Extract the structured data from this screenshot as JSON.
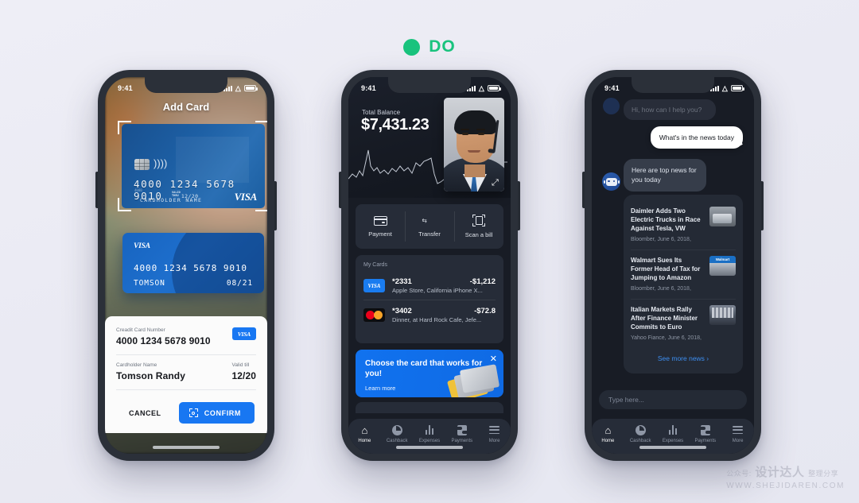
{
  "badge": {
    "label": "DO",
    "color": "#19c37d"
  },
  "watermark": {
    "line1_prefix": "公众号:",
    "line1_main": "设计达人",
    "line1_suffix": "整理分享",
    "line2": "WWW.SHEJIDAREN.COM"
  },
  "phone1": {
    "status": {
      "time": "9:41"
    },
    "title": "Add Card",
    "scanned_card": {
      "number": "4000 1234 5678 9010",
      "small_number": "4000",
      "valid_label": "VALID\nTHRU",
      "expiry": "12/20",
      "holder": "CARDHOLDER NAME",
      "brand": "VISA"
    },
    "preview_card": {
      "brand": "VISA",
      "number": "4000 1234 5678 9010",
      "holder": "TOMSON",
      "expiry": "08/21"
    },
    "form": {
      "number_label": "Creadit Card Number",
      "number_value": "4000 1234 5678 9010",
      "brand_chip": "VISA",
      "name_label": "Cardholder Name",
      "name_value": "Tomson Randy",
      "valid_label": "Valid till",
      "valid_value": "12/20",
      "cancel": "CANCEL",
      "confirm": "CONFIRM"
    }
  },
  "phone2": {
    "status": {
      "time": "9:41"
    },
    "balance_label": "Total Balance",
    "balance_amount": "$7,431.23",
    "quick_actions": [
      {
        "label": "Payment",
        "icon": "credit-card-icon"
      },
      {
        "label": "Transfer",
        "icon": "transfer-arrows-icon"
      },
      {
        "label": "Scan a bill",
        "icon": "scan-bill-icon"
      }
    ],
    "my_cards": {
      "title": "My Cards",
      "transactions": [
        {
          "brand": "VISA",
          "card": "*2331",
          "amount": "-$1,212",
          "desc": "Apple Store, California iPhone X..."
        },
        {
          "brand": "Mastercard",
          "card": "*3402",
          "amount": "-$72.8",
          "desc": "Dinner, at Hard Rock Cafe, Jefe..."
        }
      ]
    },
    "promo": {
      "headline": "Choose the card that works for you!",
      "link": "Learn more",
      "close": "✕"
    },
    "tabs": [
      {
        "label": "Home",
        "icon": "home-icon",
        "active": true
      },
      {
        "label": "Cashback",
        "icon": "pie-chart-icon",
        "active": false
      },
      {
        "label": "Expenses",
        "icon": "bar-chart-icon",
        "active": false
      },
      {
        "label": "Payments",
        "icon": "payments-icon",
        "active": false
      },
      {
        "label": "More",
        "icon": "hamburger-icon",
        "active": false
      }
    ]
  },
  "phone3": {
    "status": {
      "time": "9:41"
    },
    "messages": {
      "greeting": "Hi, how can I help you?",
      "user_query": "What's in the news today",
      "bot_reply": "Here are top news for you today"
    },
    "news": [
      {
        "title": "Daimler Adds Two Electric Trucks in Race Against Tesla, VW",
        "meta": "Bloomber, June 6, 2018,",
        "thumb": "truck-thumbnail"
      },
      {
        "title": "Walmart Sues Its Former Head of Tax for Jumping to Amazon",
        "meta": "Bloomber, June 6, 2018,",
        "thumb": "walmart-thumbnail",
        "thumb_text": "Walmart"
      },
      {
        "title": "Italian Markets Rally After Finance Minister Commits to Euro",
        "meta": "Yahoo Fiance, June 6, 2018,",
        "thumb": "market-thumbnail"
      }
    ],
    "see_more": "See more news ›",
    "composer_placeholder": "Type here...",
    "tabs": [
      {
        "label": "Home",
        "icon": "home-icon",
        "active": true
      },
      {
        "label": "Cashback",
        "icon": "pie-chart-icon",
        "active": false
      },
      {
        "label": "Expenses",
        "icon": "bar-chart-icon",
        "active": false
      },
      {
        "label": "Payments",
        "icon": "payments-icon",
        "active": false
      },
      {
        "label": "More",
        "icon": "hamburger-icon",
        "active": false
      }
    ]
  }
}
